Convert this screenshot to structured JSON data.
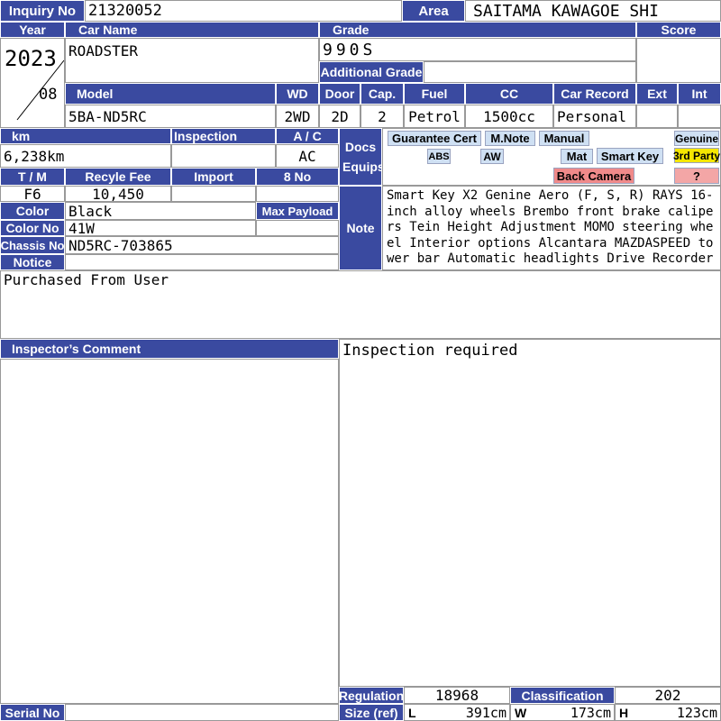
{
  "labels": {
    "inquiry_no": "Inquiry No",
    "area": "Area",
    "year": "Year",
    "car_name": "Car Name",
    "grade": "Grade",
    "score": "Score",
    "additional_grade": "Additional Grade",
    "model": "Model",
    "wd": "WD",
    "door": "Door",
    "cap": "Cap.",
    "fuel": "Fuel",
    "cc": "CC",
    "car_record": "Car Record",
    "ext": "Ext",
    "int": "Int",
    "km": "km",
    "inspection": "Inspection",
    "ac": "A / C",
    "docs_equips": "Docs Equips",
    "tm": "T / M",
    "recycle_fee": "Recyle Fee",
    "import": "Import",
    "eight_no": "8 No",
    "color": "Color",
    "max_payload": "Max Payload",
    "color_no": "Color No",
    "note": "Note",
    "chassis_no": "Chassis No",
    "notice": "Notice",
    "inspectors_comment": "Inspector’s Comment",
    "regulation": "Regulation",
    "classification": "Classification",
    "size_ref": "Size (ref)",
    "serial_no": "Serial No",
    "l": "L",
    "w": "W",
    "h": "H"
  },
  "values": {
    "inquiry_no": "21320052",
    "area": "SAITAMA KAWAGOE SHI",
    "year": "2023",
    "month": "08",
    "car_name": "ROADSTER",
    "grade": "990S",
    "additional_grade": "",
    "model": "5BA-ND5RC",
    "wd": "2WD",
    "door": "2D",
    "cap": "2",
    "fuel": "Petrol",
    "cc": "1500cc",
    "car_record": "Personal",
    "ext": "",
    "int": "",
    "km": "6,238km",
    "inspection": "",
    "ac": "AC",
    "tm": "F6",
    "recycle_fee": "10,450",
    "import": "",
    "eight_no": "",
    "color": "Black",
    "max_payload": "",
    "color_no": "41W",
    "chassis_no": "ND5RC-703865",
    "note": "Smart Key X2 Genine Aero (F, S, R) RAYS 16-inch alloy wheels Brembo front brake calipers Tein Height Adjustment MOMO steering wheel Interior options Alcantara MAZDASPEED tower bar Automatic headlights Drive Recorder",
    "notice": "Purchased From User",
    "inspection_required": "Inspection required",
    "regulation": "18968",
    "classification": "202",
    "size_l": "391cm",
    "size_w": "173cm",
    "size_h": "123cm",
    "serial_no": ""
  },
  "equip_tags": {
    "guarantee_cert": "Guarantee Cert",
    "m_note": "M.Note",
    "manual": "Manual",
    "genuine": "Genuine",
    "abs": "ABS",
    "aw": "AW",
    "mat": "Mat",
    "smart_key": "Smart Key",
    "third_party": "3rd Party",
    "back_camera": "Back Camera",
    "question": "?"
  },
  "colors": {
    "header_blue": "#3a4aa0",
    "tag_blue": "#cfe0f3",
    "tag_red": "#f08a8a",
    "tag_yellow": "#f5e600"
  }
}
